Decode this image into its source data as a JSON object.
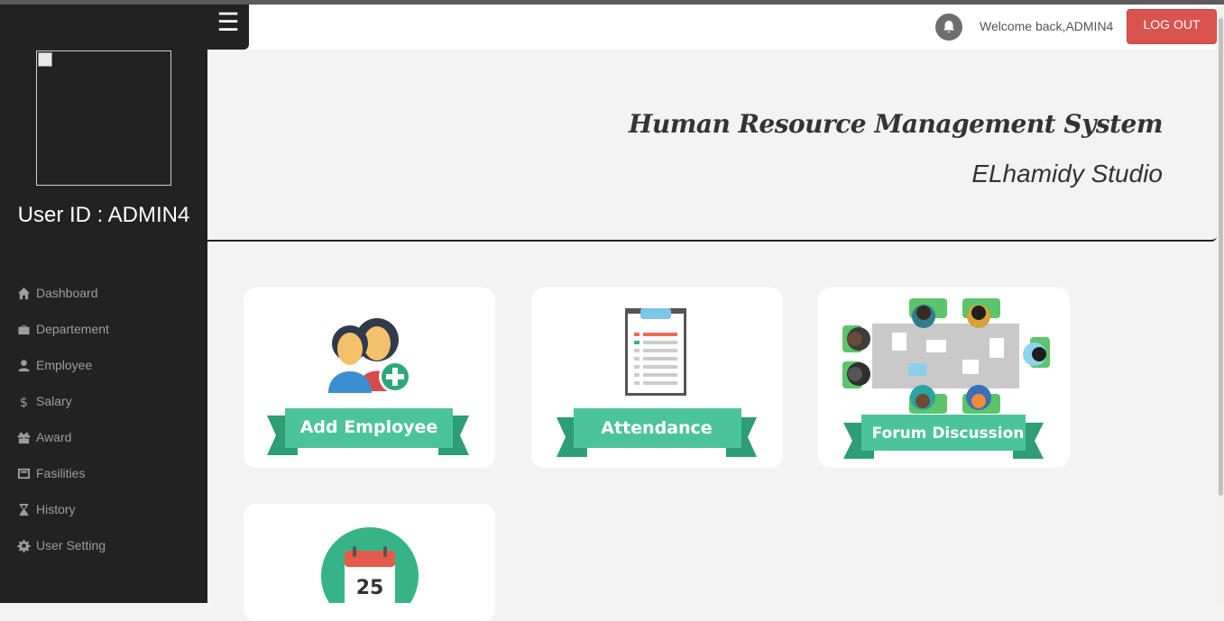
{
  "user": {
    "id_label": "User ID : ADMIN4"
  },
  "nav": {
    "items": [
      {
        "label": "Dashboard",
        "icon": "home-icon"
      },
      {
        "label": "Departement",
        "icon": "briefcase-icon"
      },
      {
        "label": "Employee",
        "icon": "user-icon"
      },
      {
        "label": "Salary",
        "icon": "dollar-icon"
      },
      {
        "label": "Award",
        "icon": "gift-icon"
      },
      {
        "label": "Fasilities",
        "icon": "card-icon"
      },
      {
        "label": "History",
        "icon": "hourglass-icon"
      },
      {
        "label": "User Setting",
        "icon": "gear-icon"
      }
    ]
  },
  "topbar": {
    "menu_toggle": "☰",
    "welcome": "Welcome back,ADMIN4",
    "logout_label": "LOG OUT"
  },
  "header": {
    "title": "Human Resource Management System",
    "subtitle": "ELhamidy Studio"
  },
  "cards": [
    {
      "label": "Add Employee"
    },
    {
      "label": "Attendance"
    },
    {
      "label": "Forum Discussion"
    },
    {
      "label": "",
      "calendar_day": "25"
    }
  ],
  "colors": {
    "sidebar": "#222222",
    "accent_green": "#4cc49b",
    "logout": "#d9534f"
  }
}
